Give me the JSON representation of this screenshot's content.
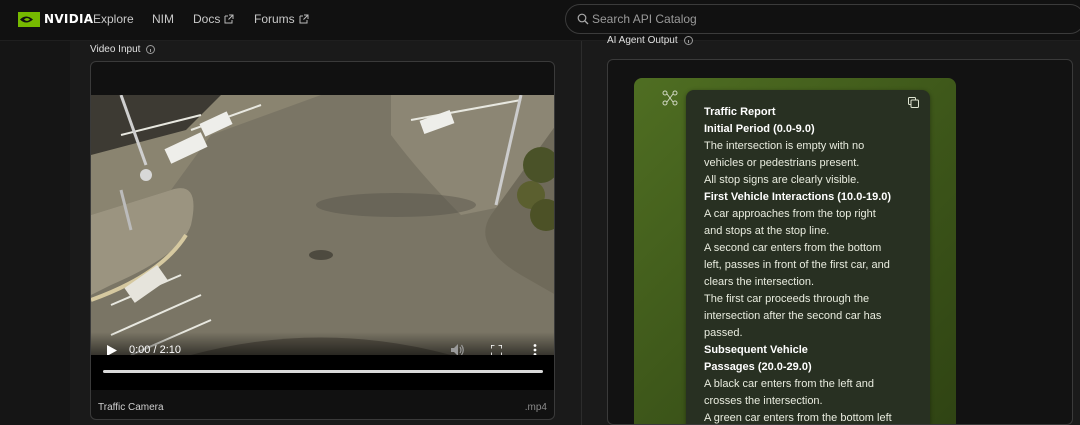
{
  "brand": {
    "name": "NVIDIA",
    "accent": "#76b900"
  },
  "nav": {
    "items": [
      {
        "label": "Explore"
      },
      {
        "label": "NIM"
      },
      {
        "label": "Docs"
      },
      {
        "label": "Forums"
      }
    ]
  },
  "search": {
    "placeholder": "Search API Catalog",
    "value": ""
  },
  "video_input": {
    "label": "Video Input",
    "current_time": "0:00",
    "duration": "2:10",
    "time_text": "0:00 / 2:10",
    "progress": 0.0,
    "file_name": "Traffic Camera",
    "file_ext": ".mp4"
  },
  "ai_output": {
    "label": "AI Agent Output",
    "lines": [
      {
        "text": "Traffic Report",
        "heading": true
      },
      {
        "text": "Initial Period (0.0-9.0)",
        "heading": true
      },
      {
        "text": "The intersection is empty with no"
      },
      {
        "text": "vehicles or pedestrians present."
      },
      {
        "text": "All stop signs are clearly visible."
      },
      {
        "text": "First Vehicle Interactions (10.0-19.0)",
        "heading": true
      },
      {
        "text": "A car approaches from the top right"
      },
      {
        "text": "and stops at the stop line."
      },
      {
        "text": "A second car enters from the bottom"
      },
      {
        "text": "left, passes in front of the first car, and"
      },
      {
        "text": "clears the intersection."
      },
      {
        "text": "The first car proceeds through the"
      },
      {
        "text": "intersection after the second car has"
      },
      {
        "text": "passed."
      },
      {
        "text": "Subsequent Vehicle",
        "heading": true
      },
      {
        "text": "Passages (20.0-29.0)",
        "heading": true
      },
      {
        "text": "A black car enters from the left and"
      },
      {
        "text": "crosses the intersection."
      },
      {
        "text": "A green car enters from the bottom left"
      }
    ]
  }
}
